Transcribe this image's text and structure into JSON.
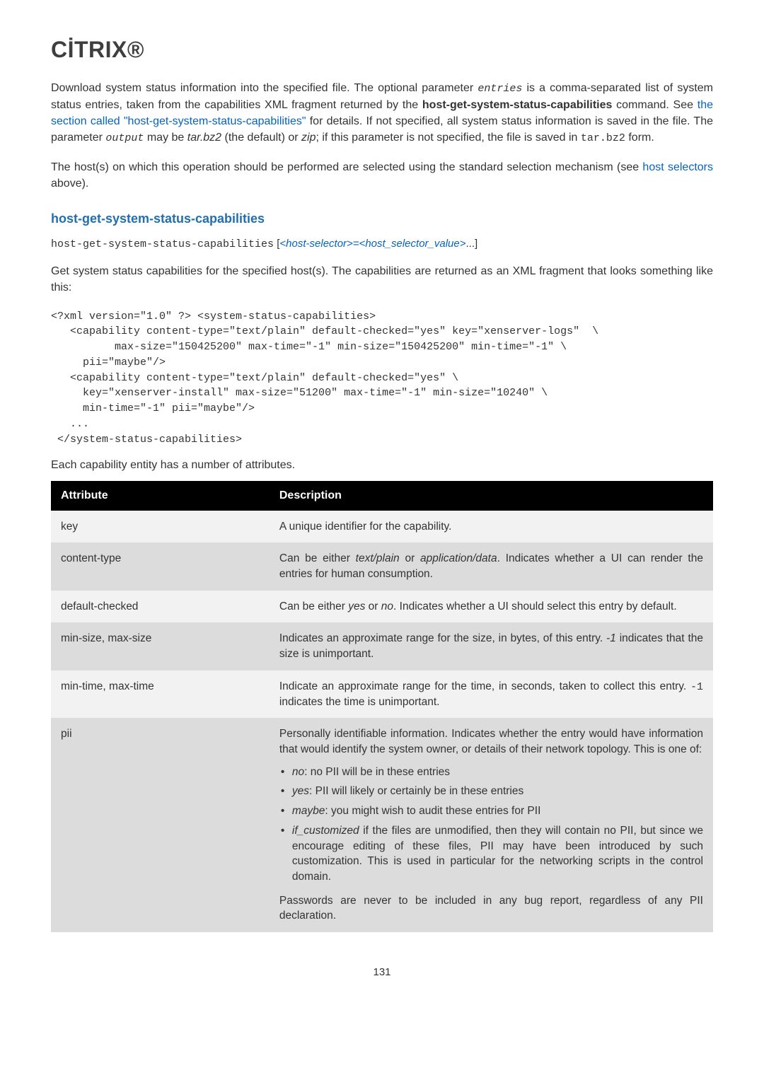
{
  "logo": "CİTRIX®",
  "intro_p1_parts": {
    "a": "Download system status information into the specified file. The optional parameter ",
    "entries": "entries",
    "b": " is a comma-separated list of system status entries, taken from the capabilities XML fragment returned by the ",
    "cmdbold": "host-get-system-status-capabilities",
    "c": " command. See ",
    "link": "the section called \"host-get-system-status-capabilities\"",
    "d": " for details. If not specified, all system status information is saved in the file. The parameter ",
    "output": "output",
    "e": " may be ",
    "tarbz2": "tar.bz2",
    "f": " (the default) or ",
    "zip": "zip",
    "g": "; if this parameter is not specified, the file is saved in ",
    "tarbz2code": "tar.bz2",
    "h": " form."
  },
  "intro_p2_parts": {
    "a": "The host(s) on which this operation should be performed are selected using the standard selection mechanism (see ",
    "link": "host selectors",
    "b": " above)."
  },
  "section_title": "host-get-system-status-capabilities",
  "cmdline": {
    "cmd": "host-get-system-status-capabilities",
    "open": " [",
    "arg": "<host-selector>=<host_selector_value>",
    "close": "...]"
  },
  "section_p": "Get system status capabilities for the specified host(s). The capabilities are returned as an XML fragment that looks something like this:",
  "codeblock": "<?xml version=\"1.0\" ?> <system-status-capabilities>\n   <capability content-type=\"text/plain\" default-checked=\"yes\" key=\"xenserver-logs\"  \\\n          max-size=\"150425200\" max-time=\"-1\" min-size=\"150425200\" min-time=\"-1\" \\\n     pii=\"maybe\"/>\n   <capability content-type=\"text/plain\" default-checked=\"yes\" \\\n     key=\"xenserver-install\" max-size=\"51200\" max-time=\"-1\" min-size=\"10240\" \\\n     min-time=\"-1\" pii=\"maybe\"/>\n   ...\n </system-status-capabilities>",
  "after_code": "Each capability entity has a number of attributes.",
  "table": {
    "headers": {
      "attr": "Attribute",
      "desc": "Description"
    },
    "rows": [
      {
        "attr": "key",
        "desc": "A unique identifier for the capability."
      },
      {
        "attr": "content-type",
        "desc_parts": {
          "a": "Can be either ",
          "i1": "text/plain",
          "b": " or ",
          "i2": "application/data",
          "c": ". Indicates whether a UI can render the entries for human consumption."
        }
      },
      {
        "attr": "default-checked",
        "desc_parts": {
          "a": "Can be either ",
          "i1": "yes",
          "b": " or ",
          "i2": "no",
          "c": ". Indicates whether a UI should select this entry by default."
        }
      },
      {
        "attr": "min-size, max-size",
        "desc_parts": {
          "a": "Indicates an approximate range for the size, in bytes, of this entry. ",
          "i1": "-1",
          "b": " indicates that the size is unimportant."
        }
      },
      {
        "attr": "min-time, max-time",
        "desc_parts": {
          "a": "Indicate an approximate range for the time, in seconds, taken to collect this entry. ",
          "code": "-1",
          "b": " indicates the time is unimportant."
        }
      },
      {
        "attr": "pii",
        "pii": {
          "p1": "Personally identifiable information. Indicates whether the entry would have information that would identify the system owner, or details of their network topology. This is one of:",
          "bullets": [
            {
              "em": "no",
              "rest": ": no PII will be in these entries"
            },
            {
              "em": "yes",
              "rest": ": PII will likely or certainly be in these entries"
            },
            {
              "em": "maybe",
              "rest": ": you might wish to audit these entries for PII"
            },
            {
              "em": "if_customized",
              "rest": " if the files are unmodified, then they will contain no PII, but since we encourage editing of these files, PII may have been introduced by such customization. This is used in particular for the networking scripts in the control domain."
            }
          ],
          "p2": "Passwords are never to be included in any bug report, regardless of any PII declaration."
        }
      }
    ]
  },
  "pagenum": "131"
}
